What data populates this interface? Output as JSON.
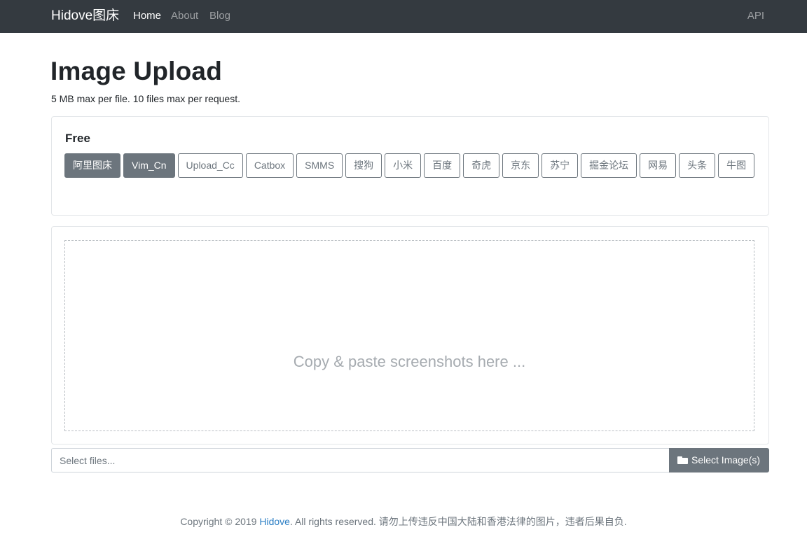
{
  "navbar": {
    "brand": "Hidove图床",
    "links": [
      {
        "label": "Home",
        "active": true
      },
      {
        "label": "About"
      },
      {
        "label": "Blog"
      }
    ],
    "api_label": "API"
  },
  "header": {
    "title": "Image Upload",
    "subtitle": "5 MB max per file. 10 files max per request."
  },
  "hosts": {
    "title": "Free",
    "items": [
      {
        "label": "阿里图床",
        "selected": true
      },
      {
        "label": "Vim_Cn",
        "selected": true
      },
      {
        "label": "Upload_Cc",
        "selected": false
      },
      {
        "label": "Catbox",
        "selected": false
      },
      {
        "label": "SMMS",
        "selected": false
      },
      {
        "label": "搜狗",
        "selected": false
      },
      {
        "label": "小米",
        "selected": false
      },
      {
        "label": "百度",
        "selected": false
      },
      {
        "label": "奇虎",
        "selected": false
      },
      {
        "label": "京东",
        "selected": false
      },
      {
        "label": "苏宁",
        "selected": false
      },
      {
        "label": "掘金论坛",
        "selected": false
      },
      {
        "label": "网易",
        "selected": false
      },
      {
        "label": "头条",
        "selected": false
      },
      {
        "label": "牛图",
        "selected": false
      }
    ]
  },
  "dropzone": {
    "text": "Copy & paste screenshots here ..."
  },
  "file_select": {
    "placeholder": "Select files...",
    "button_label": "Select Image(s)",
    "button_icon": "folder-open-icon"
  },
  "footer": {
    "prefix": "Copyright © 2019 ",
    "link_text": "Hidove",
    "suffix": ". All rights reserved. 请勿上传违反中国大陆和香港法律的图片，违者后果自负."
  },
  "colors": {
    "navbar_bg": "#343a40",
    "secondary": "#6c757d",
    "link": "#2b7ec4"
  }
}
